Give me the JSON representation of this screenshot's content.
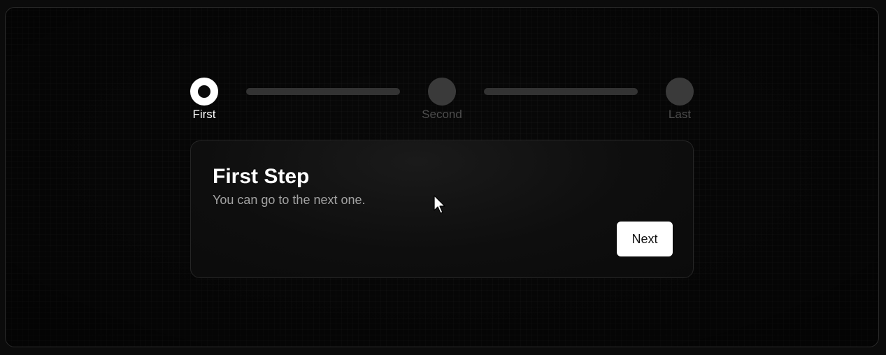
{
  "stepper": {
    "steps": [
      {
        "label": "First",
        "state": "active"
      },
      {
        "label": "Second",
        "state": "inactive"
      },
      {
        "label": "Last",
        "state": "inactive"
      }
    ]
  },
  "card": {
    "title": "First Step",
    "description": "You can go to the next one.",
    "next_label": "Next"
  },
  "colors": {
    "background": "#080808",
    "active": "#ffffff",
    "inactive": "#3a3a3a",
    "inactive_text": "#4d4d4d",
    "muted_text": "#a3a3a3"
  },
  "icons": {
    "cursor": "mouse-pointer-icon"
  }
}
